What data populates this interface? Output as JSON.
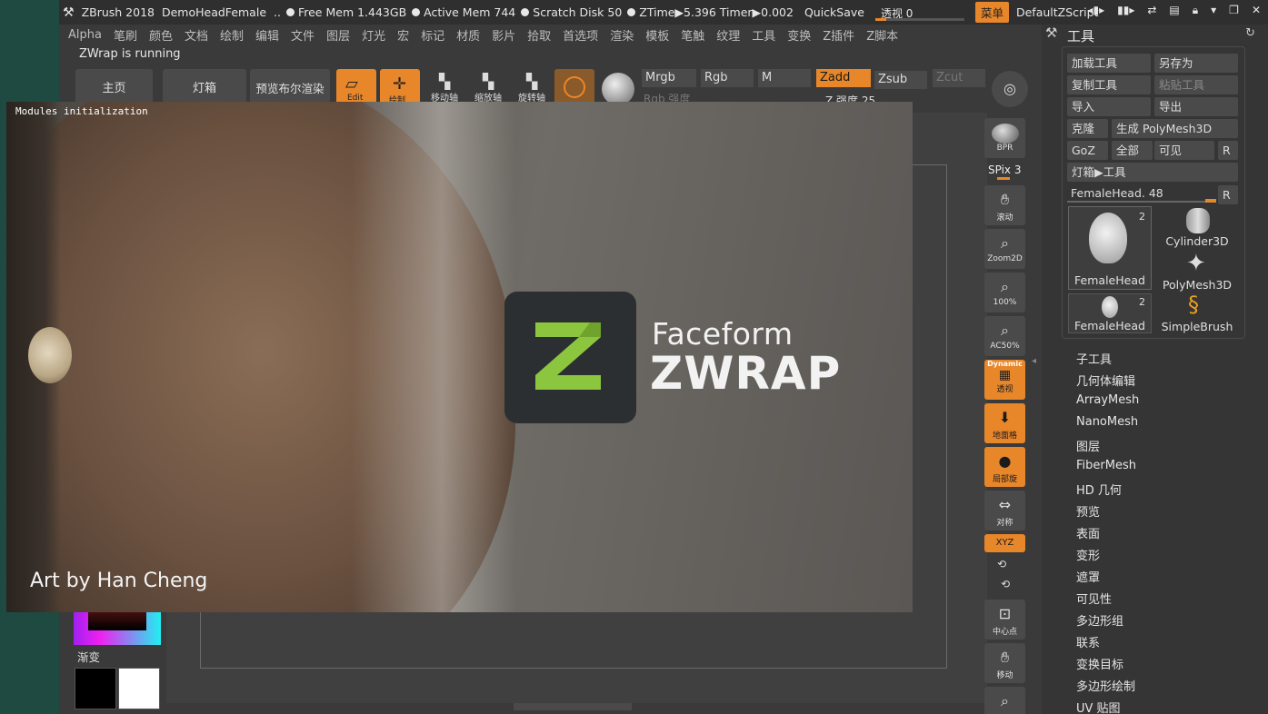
{
  "titlebar": {
    "app": "ZBrush 2018",
    "doc": "DemoHeadFemale",
    "sep": "..",
    "free_mem": "Free Mem 1.443GB",
    "active_mem": "Active Mem 744",
    "scratch": "Scratch Disk 50",
    "ztime": "ZTime▶5.396 Timer▶0.002",
    "quicksave": "QuickSave",
    "persp_label": "透视 0",
    "menu": "菜单",
    "script": "DefaultZScript"
  },
  "menubar": [
    "Alpha",
    "笔刷",
    "颜色",
    "文档",
    "绘制",
    "编辑",
    "文件",
    "图层",
    "灯光",
    "宏",
    "标记",
    "材质",
    "影片",
    "拾取",
    "首选项",
    "渲染",
    "模板",
    "笔触",
    "纹理",
    "工具",
    "变换",
    "Z插件",
    "Z脚本"
  ],
  "status": "ZWrap is running",
  "shelf": {
    "home": "主页",
    "lightbox": "灯箱",
    "preview": "预览布尔渲染",
    "edit": "Edit",
    "draw": "绘制",
    "move": "移动轴",
    "scale": "缩放轴",
    "rotate": "旋转轴"
  },
  "channels": {
    "mrgb": "Mrgb",
    "rgb": "Rgb",
    "m": "M",
    "zadd": "Zadd",
    "zsub": "Zsub",
    "zcut": "Zcut",
    "rgb_intensity": "Rgb 强度",
    "z_intensity": "Z 强度 25"
  },
  "splash": {
    "modules": "Modules initialization",
    "brand_small": "Faceform",
    "brand_big": "ZWRAP",
    "credit": "Art by Han Cheng"
  },
  "left": {
    "gradient": "渐变"
  },
  "rightstrip": {
    "bpr": "BPR",
    "spix": "SPix 3",
    "scroll": "滚动",
    "zoom2d": "Zoom2D",
    "p100": "100%",
    "ac50": "AC50%",
    "dynamic": "Dynamic",
    "persp": "透视",
    "floor": "地面格",
    "local": "局部旋",
    "sym": "对称",
    "xyz": "XYZ",
    "center": "中心点",
    "move": "移动"
  },
  "panel": {
    "title": "工具",
    "buttons": [
      "加载工具",
      "另存为",
      "复制工具",
      "粘贴工具",
      "导入",
      "导出",
      "克隆",
      "生成 PolyMesh3D",
      "GoZ",
      "全部",
      "可见",
      "R",
      "灯箱▶工具"
    ],
    "slider": "FemaleHead. 48",
    "slider_r": "R",
    "thumbs": [
      {
        "name": "FemaleHead",
        "count": "2"
      },
      {
        "name": "Cylinder3D",
        "count": ""
      },
      {
        "name": "PolyMesh3D",
        "count": ""
      },
      {
        "name": "FemaleHead",
        "count": "2"
      },
      {
        "name": "SimpleBrush",
        "count": ""
      }
    ],
    "submenus": [
      "子工具",
      "几何体编辑",
      "ArrayMesh",
      "NanoMesh",
      "图层",
      "FiberMesh",
      "HD 几何",
      "预览",
      "表面",
      "变形",
      "遮罩",
      "可见性",
      "多边形组",
      "联系",
      "变换目标",
      "多边形绘制",
      "UV 贴图"
    ]
  },
  "colors": {
    "accent": "#e8862a",
    "zwrap_green": "#8cc63f"
  }
}
